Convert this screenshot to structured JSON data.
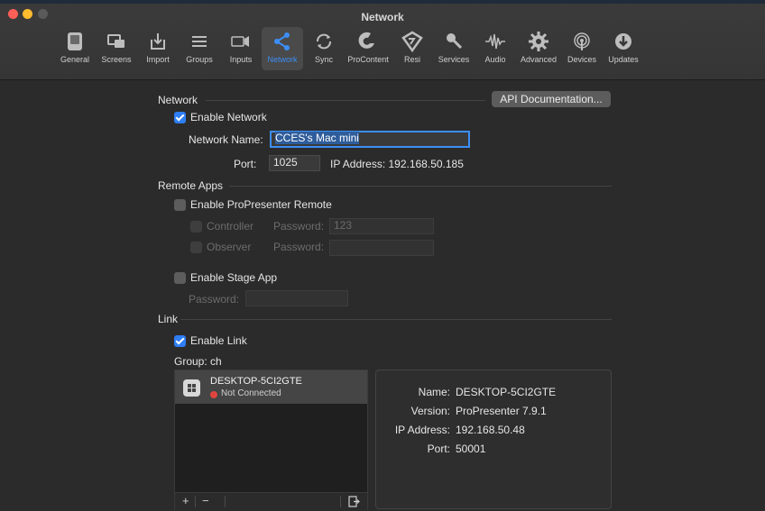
{
  "window": {
    "title": "Network"
  },
  "toolbar": {
    "items": [
      {
        "label": "General",
        "icon": "general-icon"
      },
      {
        "label": "Screens",
        "icon": "screens-icon"
      },
      {
        "label": "Import",
        "icon": "import-icon"
      },
      {
        "label": "Groups",
        "icon": "groups-icon"
      },
      {
        "label": "Inputs",
        "icon": "inputs-icon"
      },
      {
        "label": "Network",
        "icon": "network-icon",
        "selected": true
      },
      {
        "label": "Sync",
        "icon": "sync-icon"
      },
      {
        "label": "ProContent",
        "icon": "procontent-icon"
      },
      {
        "label": "Resi",
        "icon": "resi-icon"
      },
      {
        "label": "Services",
        "icon": "services-icon"
      },
      {
        "label": "Audio",
        "icon": "audio-icon"
      },
      {
        "label": "Advanced",
        "icon": "advanced-icon"
      },
      {
        "label": "Devices",
        "icon": "devices-icon"
      },
      {
        "label": "Updates",
        "icon": "updates-icon"
      }
    ]
  },
  "network": {
    "section_label": "Network",
    "api_button": "API Documentation...",
    "enable_label": "Enable Network",
    "enabled": true,
    "name_label": "Network Name:",
    "name_value": "CCES's Mac mini",
    "port_label": "Port:",
    "port_value": "1025",
    "ip_text": "IP Address: 192.168.50.185"
  },
  "remote": {
    "section_label": "Remote Apps",
    "enable_label": "Enable ProPresenter Remote",
    "controller_label": "Controller",
    "controller_password_label": "Password:",
    "controller_password_value": "123",
    "observer_label": "Observer",
    "observer_password_label": "Password:",
    "observer_password_value": "",
    "stage_label": "Enable Stage App",
    "stage_password_label": "Password:",
    "stage_password_value": ""
  },
  "link": {
    "section_label": "Link",
    "enable_label": "Enable Link",
    "enabled": true,
    "group_text": "Group: ch",
    "device": {
      "name": "DESKTOP-5CI2GTE",
      "status": "Not Connected"
    },
    "details": [
      {
        "key": "Name:",
        "value": "DESKTOP-5CI2GTE"
      },
      {
        "key": "Version:",
        "value": "ProPresenter 7.9.1"
      },
      {
        "key": "IP Address:",
        "value": "192.168.50.48"
      },
      {
        "key": "Port:",
        "value": "50001"
      }
    ],
    "add_label": "+",
    "remove_label": "−"
  },
  "colors": {
    "accent": "#3d8ef7",
    "status_red": "#e0443e"
  }
}
